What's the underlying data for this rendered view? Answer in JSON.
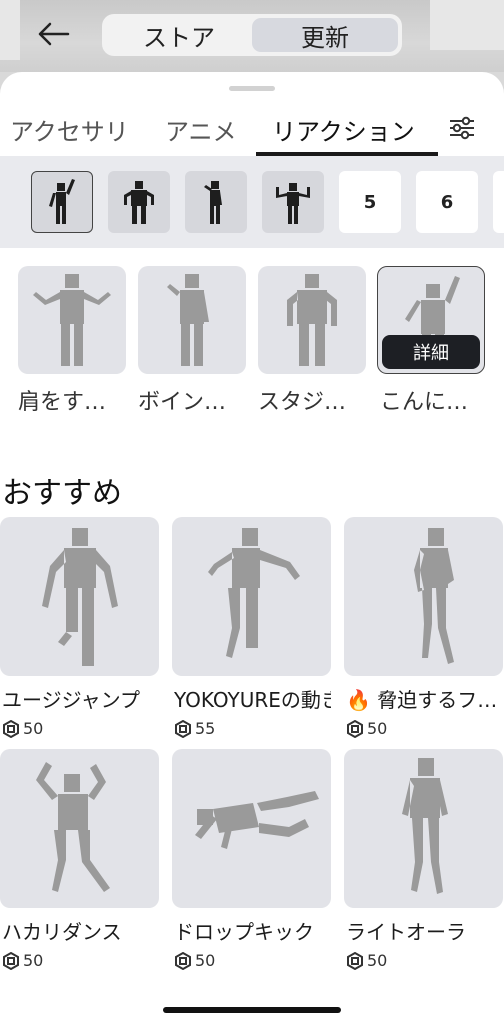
{
  "header": {
    "segments": [
      {
        "label": "ストア",
        "active": false
      },
      {
        "label": "更新",
        "active": true
      }
    ]
  },
  "tabs": {
    "items": [
      {
        "label": "アクセサリ",
        "active": false
      },
      {
        "label": "アニメ",
        "active": false
      },
      {
        "label": "リアクション",
        "active": true
      }
    ]
  },
  "slots": {
    "items": [
      {
        "label": "",
        "icon": "pose-wave-icon",
        "active": true
      },
      {
        "label": "",
        "icon": "pose-flex-icon",
        "active": false
      },
      {
        "label": "",
        "icon": "pose-point-icon",
        "active": false
      },
      {
        "label": "",
        "icon": "pose-shrug-icon",
        "active": false
      },
      {
        "label": "5",
        "active": false
      },
      {
        "label": "6",
        "active": false
      }
    ]
  },
  "equipped": {
    "items": [
      {
        "label": "肩をす…"
      },
      {
        "label": "ボイン…"
      },
      {
        "label": "スタジ…"
      },
      {
        "label": "こんに…",
        "selected": true,
        "detail_label": "詳細"
      }
    ]
  },
  "recommended": {
    "title": "おすすめ",
    "items": [
      {
        "name": "ユージジャンプ",
        "price": "50"
      },
      {
        "name": "YOKOYUREの動き",
        "price": "55"
      },
      {
        "name": "🔥 脅迫するフ…",
        "price": "50"
      },
      {
        "name": "ハカリダンス",
        "price": "50"
      },
      {
        "name": "ドロップキック",
        "price": "50"
      },
      {
        "name": "ライトオーラ",
        "price": "50"
      }
    ]
  },
  "colors": {
    "accent": "#1a1a1a",
    "card_bg": "#e2e3e8",
    "slot_bar_bg": "#e9eaee"
  }
}
